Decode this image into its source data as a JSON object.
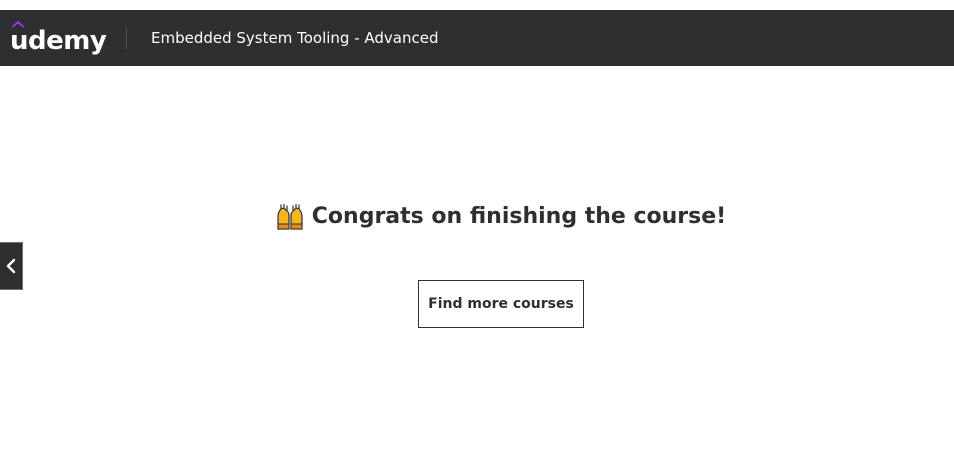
{
  "header": {
    "logo_text": "udemy",
    "course_title": "Embedded System Tooling - Advanced"
  },
  "main": {
    "congrats_text": "Congrats on finishing the course!",
    "congrats_icon": "raising-hands-icon",
    "find_button_label": "Find more courses"
  },
  "nav": {
    "prev_icon": "chevron-left-icon"
  },
  "colors": {
    "header_bg": "#2d2f31",
    "brand_accent": "#a435f0",
    "text_dark": "#2d2f31",
    "emoji_yellow": "#f5b51f"
  }
}
